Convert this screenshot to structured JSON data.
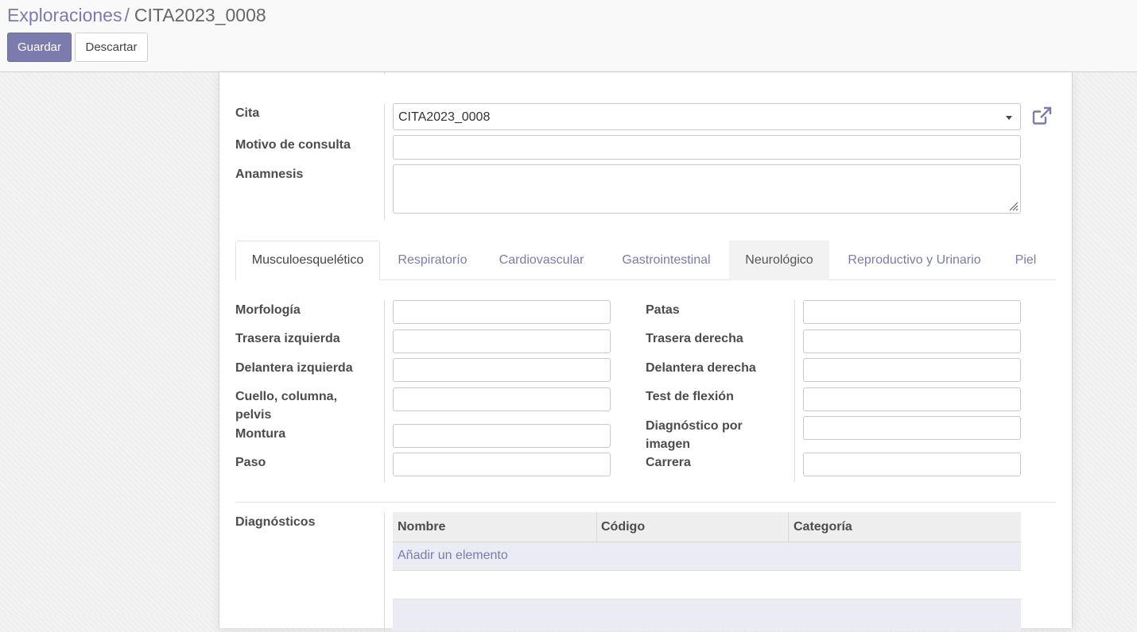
{
  "breadcrumb": {
    "parent": "Exploraciones",
    "separator": "/",
    "current": "CITA2023_0008"
  },
  "buttons": {
    "save": "Guardar",
    "discard": "Descartar"
  },
  "fields": {
    "cita": {
      "label": "Cita",
      "value": "CITA2023_0008"
    },
    "motivo": {
      "label": "Motivo de consulta",
      "value": ""
    },
    "anamnesis": {
      "label": "Anamnesis",
      "value": ""
    }
  },
  "tabs": [
    {
      "label": "Musculoesquelético",
      "state": "active"
    },
    {
      "label": "Respiratorío",
      "state": "normal"
    },
    {
      "label": "Cardiovascular",
      "state": "normal"
    },
    {
      "label": "Gastrointestinal",
      "state": "normal"
    },
    {
      "label": "Neurológico",
      "state": "hover"
    },
    {
      "label": "Reproductivo y Urinario",
      "state": "normal"
    },
    {
      "label": "Piel",
      "state": "normal"
    }
  ],
  "musculo": {
    "left": [
      {
        "label": "Morfología",
        "value": ""
      },
      {
        "label": "Trasera izquierda",
        "value": ""
      },
      {
        "label": "Delantera izquierda",
        "value": ""
      },
      {
        "label": "Cuello, columna, pelvis",
        "value": ""
      },
      {
        "label": "Montura",
        "value": ""
      },
      {
        "label": "Paso",
        "value": ""
      }
    ],
    "right": [
      {
        "label": "Patas",
        "value": ""
      },
      {
        "label": "Trasera derecha",
        "value": ""
      },
      {
        "label": "Delantera derecha",
        "value": ""
      },
      {
        "label": "Test de flexión",
        "value": ""
      },
      {
        "label": "Diagnóstico por imagen",
        "value": ""
      },
      {
        "label": "Carrera",
        "value": ""
      }
    ]
  },
  "diagnosticos": {
    "label": "Diagnósticos",
    "columns": [
      "Nombre",
      "Código",
      "Categoría"
    ],
    "add_label": "Añadir un elemento"
  },
  "icons": {
    "external": "external-link-icon",
    "dropdown": "caret-down-icon",
    "resize": "resize-grip-icon"
  },
  "colors": {
    "primary": "#7c7bad"
  }
}
